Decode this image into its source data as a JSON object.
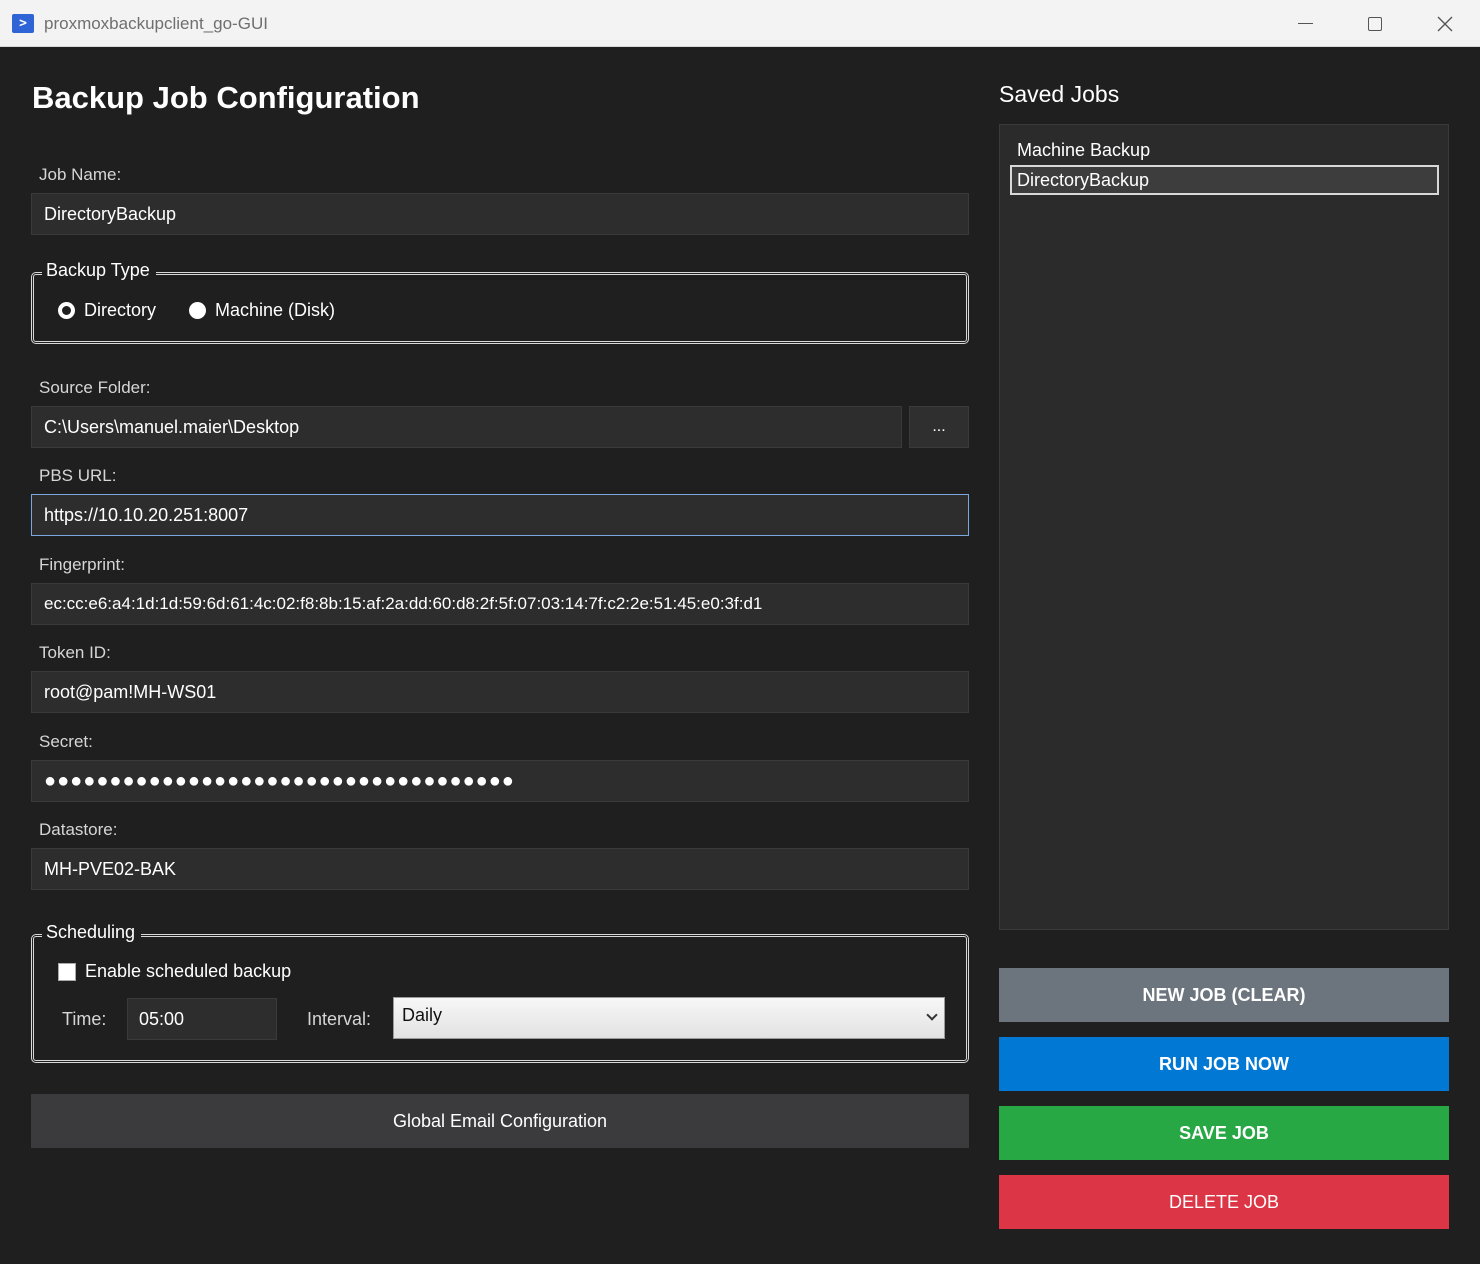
{
  "window": {
    "title": "proxmoxbackupclient_go-GUI",
    "icon": "powershell-icon"
  },
  "form": {
    "title": "Backup Job Configuration",
    "job_name": {
      "label": "Job Name:",
      "value": "DirectoryBackup"
    },
    "backup_type": {
      "legend": "Backup Type",
      "options": [
        {
          "label": "Directory",
          "checked": true
        },
        {
          "label": "Machine (Disk)",
          "checked": false
        }
      ]
    },
    "source_folder": {
      "label": "Source Folder:",
      "value": "C:\\Users\\manuel.maier\\Desktop",
      "browse_label": "..."
    },
    "pbs_url": {
      "label": "PBS URL:",
      "value": "https://10.10.20.251:8007"
    },
    "fingerprint": {
      "label": "Fingerprint:",
      "value": "ec:cc:e6:a4:1d:1d:59:6d:61:4c:02:f8:8b:15:af:2a:dd:60:d8:2f:5f:07:03:14:7f:c2:2e:51:45:e0:3f:d1"
    },
    "token_id": {
      "label": "Token ID:",
      "value": "root@pam!MH-WS01"
    },
    "secret": {
      "label": "Secret:",
      "value": "●●●●●●●●●●●●●●●●●●●●●●●●●●●●●●●●●●●●"
    },
    "datastore": {
      "label": "Datastore:",
      "value": "MH-PVE02-BAK"
    },
    "scheduling": {
      "legend": "Scheduling",
      "enable_label": "Enable scheduled backup",
      "enabled": false,
      "time_label": "Time:",
      "time_value": "05:00",
      "interval_label": "Interval:",
      "interval_value": "Daily"
    },
    "email_button": "Global Email Configuration"
  },
  "saved_jobs": {
    "title": "Saved Jobs",
    "items": [
      {
        "label": "Machine Backup",
        "selected": false
      },
      {
        "label": "DirectoryBackup",
        "selected": true
      }
    ]
  },
  "actions": {
    "new_job": {
      "label": "NEW JOB (CLEAR)",
      "color": "#6c757d"
    },
    "run_job": {
      "label": "RUN JOB NOW",
      "color": "#0078d4"
    },
    "save_job": {
      "label": "SAVE JOB",
      "color": "#28a745"
    },
    "delete_job": {
      "label": "DELETE JOB",
      "color": "#dc3545"
    }
  }
}
